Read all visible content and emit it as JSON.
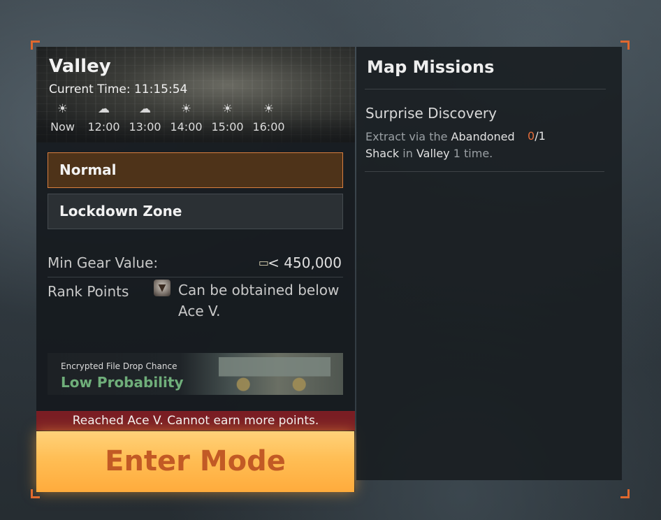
{
  "map": {
    "name": "Valley",
    "current_time": "Current Time: 11:15:54",
    "weather": [
      {
        "icon": "sun-icon",
        "glyph": "☀",
        "label": "Now"
      },
      {
        "icon": "cloud-rain-icon",
        "glyph": "☁",
        "label": "12:00"
      },
      {
        "icon": "cloud-rain-icon",
        "glyph": "☁",
        "label": "13:00"
      },
      {
        "icon": "sun-icon",
        "glyph": "☀",
        "label": "14:00"
      },
      {
        "icon": "sun-icon",
        "glyph": "☀",
        "label": "15:00"
      },
      {
        "icon": "sun-icon",
        "glyph": "☀",
        "label": "16:00"
      }
    ]
  },
  "modes": {
    "normal": "Normal",
    "lockdown": "Lockdown Zone",
    "selected": "Normal"
  },
  "requirements": {
    "min_gear_label": "Min Gear Value:",
    "min_gear_value": "< 450,000",
    "rank_label": "Rank Points",
    "rank_text": "Can be obtained below Ace V."
  },
  "file_drop": {
    "caption": "Encrypted File Drop Chance",
    "probability": "Low Probability"
  },
  "warning": "Reached Ace V. Cannot earn more points.",
  "enter_button": "Enter Mode",
  "missions": {
    "title": "Map Missions",
    "items": [
      {
        "name": "Surprise Discovery",
        "desc_prefix": "Extract via the ",
        "desc_place": "Abandoned Shack",
        "desc_mid": " in ",
        "desc_map": "Valley",
        "desc_suffix": " 1 time.",
        "progress_current": "0",
        "progress_total": "/1"
      }
    ]
  },
  "colors": {
    "accent": "#e0682e",
    "selected_mode_bg": "#4e3319",
    "warning_bg": "#7a1e24",
    "enter_text": "#c25a25",
    "probability_text": "#6fae7a"
  }
}
